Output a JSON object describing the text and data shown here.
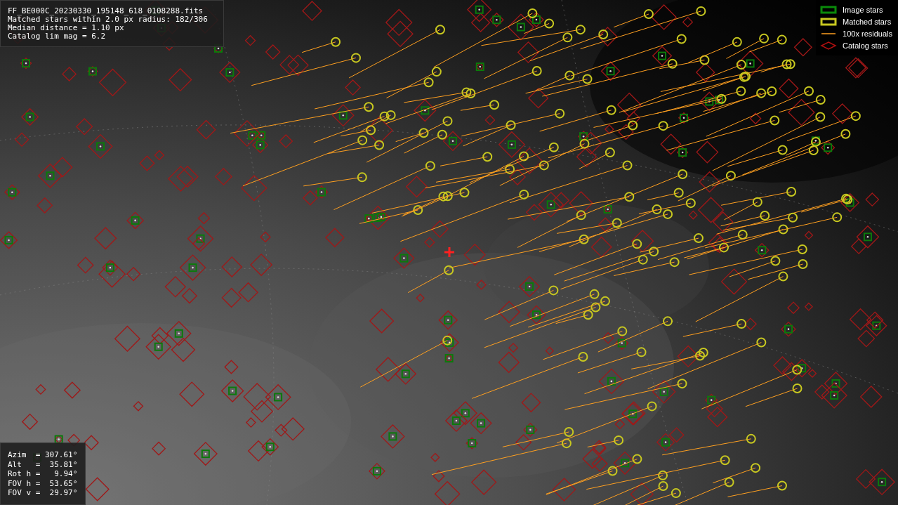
{
  "info_box": {
    "lines": [
      "FF_BE000C_20230330_195148_618_0108288.fits",
      "Matched stars within 2.0 px radius: 182/306",
      "Median distance = 1.10 px",
      "Catalog lim mag = 6.2"
    ]
  },
  "legend": [
    {
      "label": "Image stars"
    },
    {
      "kind": "matched",
      "label": "Matched stars"
    },
    {
      "kind": "residual",
      "label": "100x residuals"
    },
    {
      "kind": "catalog",
      "label": "Catalog stars"
    }
  ],
  "pointing_box": {
    "lines": [
      "Azim  = 307.61°",
      "Alt   =  35.81°",
      "Rot h =   9.94°",
      "FOV h =  53.65°",
      "FOV v =  29.97°"
    ]
  }
}
